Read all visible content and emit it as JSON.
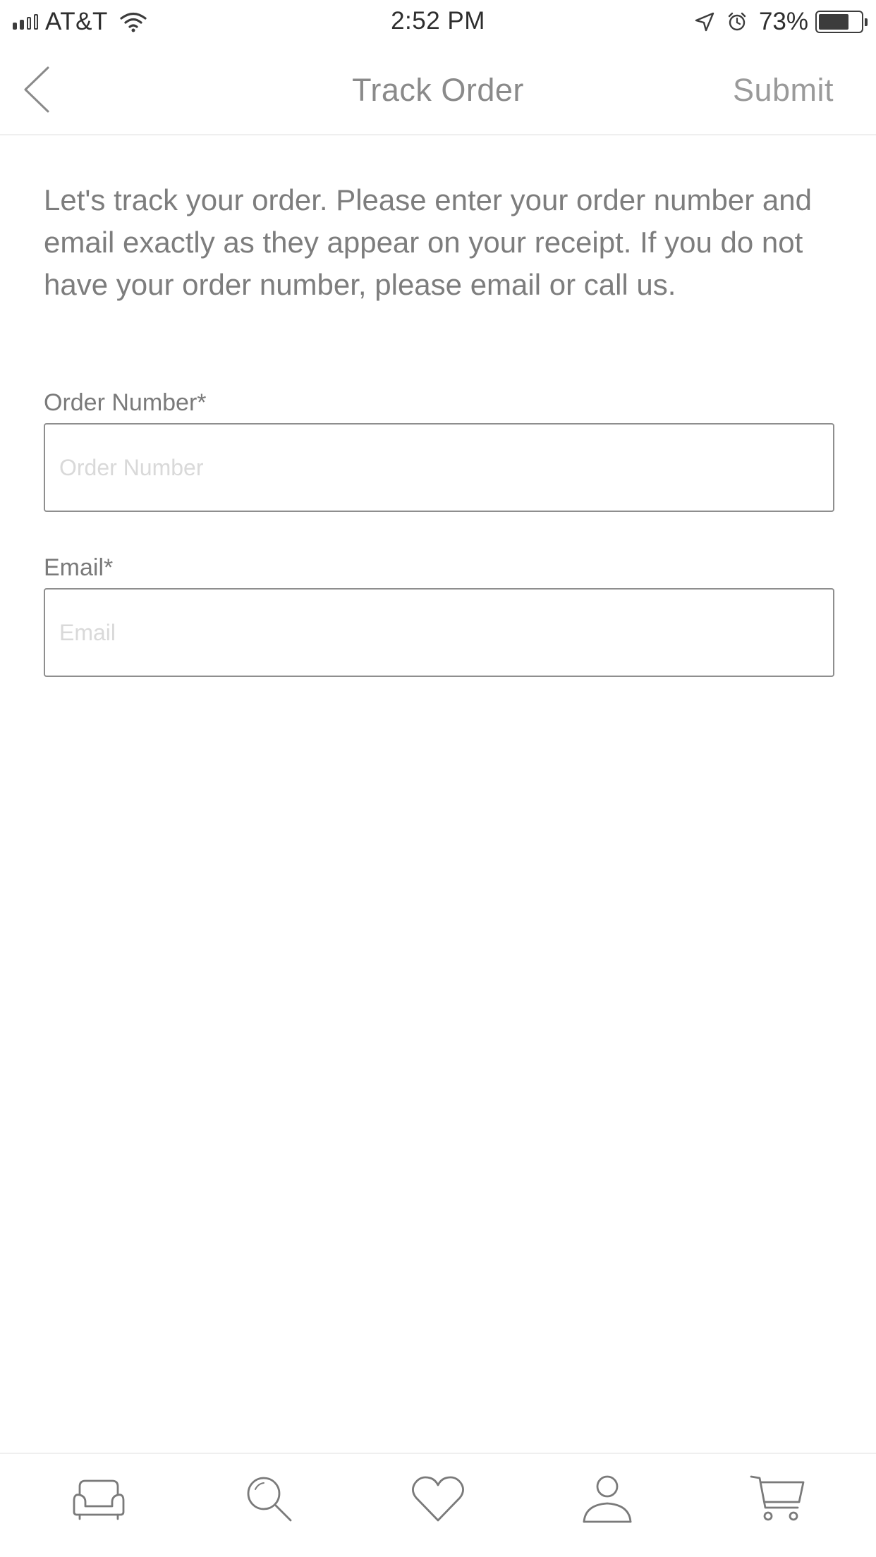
{
  "status_bar": {
    "carrier": "AT&T",
    "time": "2:52 PM",
    "battery": "73%",
    "battery_level": 0.73
  },
  "nav": {
    "title": "Track Order",
    "submit_label": "Submit",
    "back_icon": "chevron-left-icon"
  },
  "form": {
    "intro": "Let's track your order. Please enter your order number and email exactly as they appear on your receipt. If you do not have your order number, please email or call us.",
    "order_number": {
      "label": "Order Number*",
      "placeholder": "Order Number",
      "value": ""
    },
    "email": {
      "label": "Email*",
      "placeholder": "Email",
      "value": ""
    }
  },
  "tab_bar": {
    "items": [
      {
        "icon": "sofa-icon"
      },
      {
        "icon": "search-icon"
      },
      {
        "icon": "heart-icon"
      },
      {
        "icon": "person-icon"
      },
      {
        "icon": "cart-icon"
      }
    ]
  },
  "colors": {
    "text_primary": "#7d7d7d",
    "title": "#8a8a8a",
    "border": "#8e8e8e",
    "placeholder": "#d9d9d9",
    "divider": "#efefef"
  }
}
